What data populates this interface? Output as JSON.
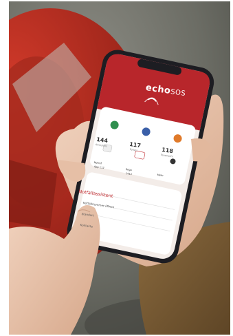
{
  "app": {
    "brand_name": "echo",
    "brand_suffix": "SOS"
  },
  "sections": {
    "emergency_title": "Notrufe",
    "wizard_title": "Notfallassistent"
  },
  "stats": [
    {
      "value": "144",
      "label": "Ambulanz",
      "color": "#2f8f4e"
    },
    {
      "value": "117",
      "label": "Polizei",
      "color": "#3a5fa8"
    },
    {
      "value": "118",
      "label": "Feuerwehr",
      "color": "#e07a2a"
    }
  ],
  "quick": [
    {
      "label": "Notruf",
      "sub": "App 112"
    },
    {
      "label": "Rega",
      "sub": "1414"
    },
    {
      "label": "Tox Info",
      "sub": "145"
    },
    {
      "label": "Mehr",
      "sub": ""
    }
  ],
  "list_rows": [
    {
      "label": "Notfallnummer öffnen",
      "value": ""
    },
    {
      "label": "Standort",
      "value": ""
    },
    {
      "label": "Kontakte",
      "value": ""
    }
  ],
  "colors": {
    "accent": "#b8262b",
    "screen_bg": "#f3ece8",
    "phone_frame": "#1d1d22"
  }
}
